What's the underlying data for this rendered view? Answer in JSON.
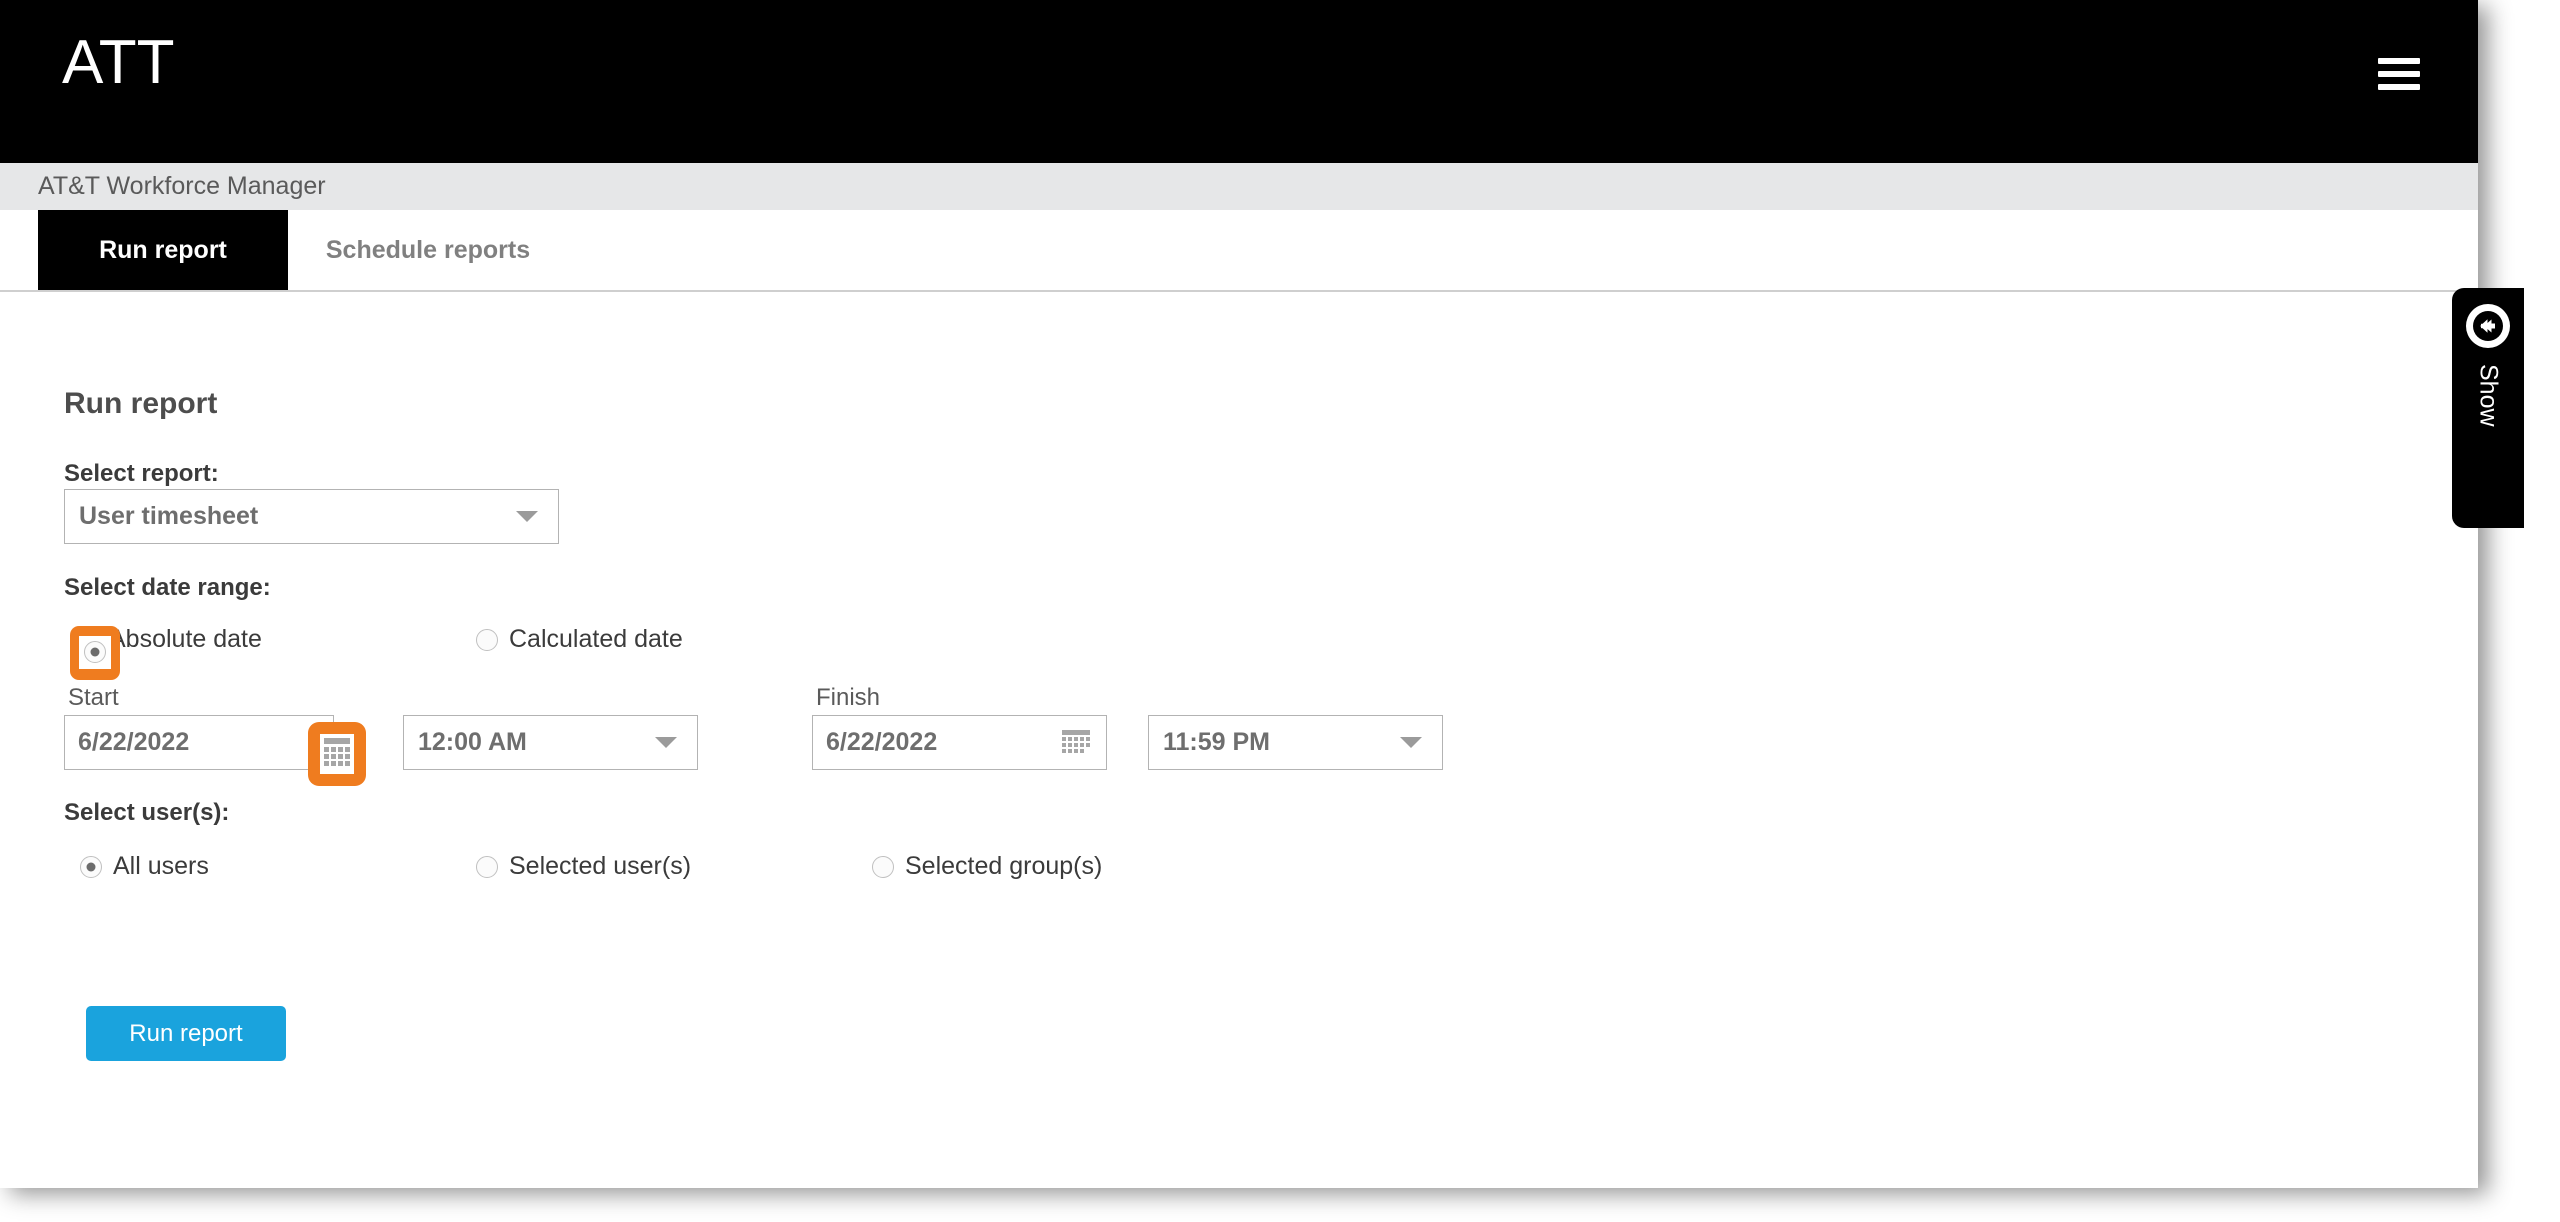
{
  "brand": {
    "logo_text": "ATT",
    "menu_icon": "hamburger-menu-icon"
  },
  "app_bar": {
    "app_name": "AT&T Workforce Manager"
  },
  "tabs": [
    {
      "label": "Run report",
      "active": true
    },
    {
      "label": "Schedule reports",
      "active": false
    }
  ],
  "main": {
    "heading": "Run report",
    "select_report": {
      "label": "Select report:",
      "value": "User timesheet",
      "caret_icon": "chevron-down-icon"
    },
    "date_range": {
      "label": "Select date range:",
      "options": [
        {
          "label": "Absolute date",
          "selected": true,
          "highlighted": true
        },
        {
          "label": "Calculated date",
          "selected": false,
          "highlighted": false
        }
      ],
      "start": {
        "label": "Start",
        "date_value": "6/22/2022",
        "calendar_icon": "calendar-icon",
        "calendar_highlighted": true,
        "time_value": "12:00 AM",
        "time_caret_icon": "chevron-down-icon"
      },
      "finish": {
        "label": "Finish",
        "date_value": "6/22/2022",
        "calendar_icon": "calendar-icon",
        "calendar_highlighted": false,
        "time_value": "11:59 PM",
        "time_caret_icon": "chevron-down-icon"
      }
    },
    "select_users": {
      "label": "Select user(s):",
      "options": [
        {
          "label": "All users",
          "selected": true
        },
        {
          "label": "Selected user(s)",
          "selected": false
        },
        {
          "label": "Selected group(s)",
          "selected": false
        }
      ]
    },
    "submit": {
      "label": "Run report"
    }
  },
  "drawer": {
    "label": "Show",
    "arrow_icon": "arrow-left-circle-icon"
  },
  "colors": {
    "brand_bar": "#000000",
    "app_bar": "#e6e7e8",
    "accent_button": "#1aa3dd",
    "annotation_highlight": "#ef7c1f"
  }
}
